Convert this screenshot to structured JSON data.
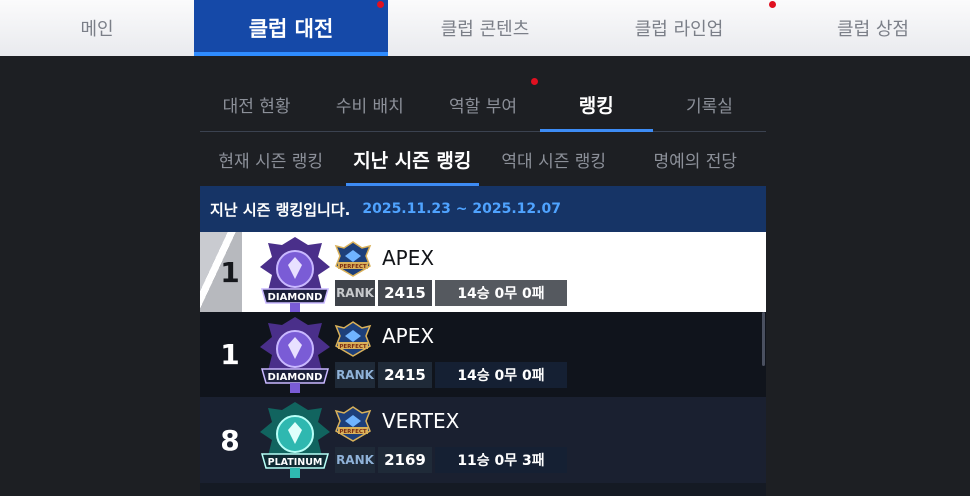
{
  "top_nav": {
    "tabs": [
      {
        "label": "메인"
      },
      {
        "label": "클럽 대전"
      },
      {
        "label": "클럽 콘텐츠"
      },
      {
        "label": "클럽 라인업"
      },
      {
        "label": "클럽 상점"
      }
    ],
    "active_index": 1
  },
  "sub_tabs": {
    "tabs": [
      {
        "label": "대전 현황"
      },
      {
        "label": "수비 배치"
      },
      {
        "label": "역할 부여"
      },
      {
        "label": "랭킹"
      },
      {
        "label": "기록실"
      }
    ],
    "active_index": 3
  },
  "season_tabs": {
    "tabs": [
      {
        "label": "현재 시즌 랭킹"
      },
      {
        "label": "지난 시즌 랭킹"
      },
      {
        "label": "역대 시즌 랭킹"
      },
      {
        "label": "명예의 전당"
      }
    ],
    "active_index": 1
  },
  "ranking": {
    "header_text": "지난 시즌 랭킹입니다.",
    "season_range": "2025.11.23 ~ 2025.12.07",
    "rank_label": "RANK",
    "rows": [
      {
        "rank": "1",
        "tier": "DIAMOND",
        "badge_text": "PERFECT",
        "club": "APEX",
        "score": "2415",
        "record": "14승 0무 0패",
        "tier_color": "#7a5cd6"
      },
      {
        "rank": "1",
        "tier": "DIAMOND",
        "badge_text": "PERFECT",
        "club": "APEX",
        "score": "2415",
        "record": "14승 0무 0패",
        "tier_color": "#7a5cd6"
      },
      {
        "rank": "8",
        "tier": "PLATINUM",
        "badge_text": "PERFECT",
        "club": "VERTEX",
        "score": "2169",
        "record": "11승 0무 3패",
        "tier_color": "#2fb8b0"
      }
    ]
  }
}
